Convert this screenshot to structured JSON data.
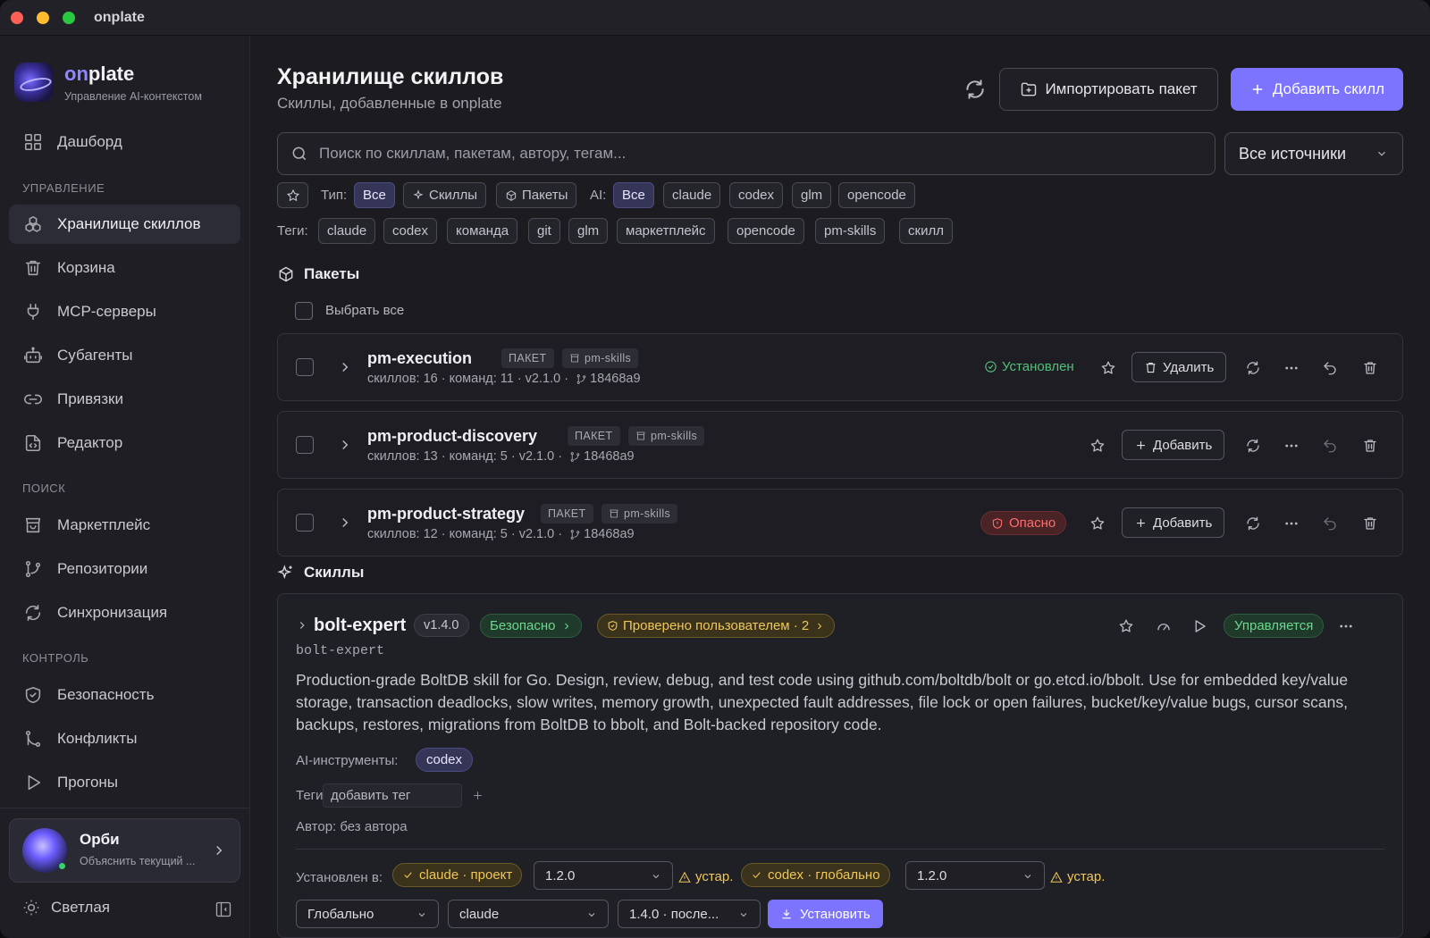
{
  "window": {
    "title": "onplate"
  },
  "brand": {
    "name_accent": "on",
    "name_rest": "plate",
    "subtitle": "Управление AI-контекстом"
  },
  "sidebar": {
    "dashboard": "Дашборд",
    "section_manage": "УПРАВЛЕНИЕ",
    "skills": "Хранилище скиллов",
    "trash": "Корзина",
    "mcp": "MCP-серверы",
    "subagents": "Субагенты",
    "bindings": "Привязки",
    "editor": "Редактор",
    "section_search": "ПОИСК",
    "marketplace": "Маркетплейс",
    "repos": "Репозитории",
    "sync": "Синхронизация",
    "section_control": "КОНТРОЛЬ",
    "security": "Безопасность",
    "conflicts": "Конфликты",
    "runs": "Прогоны",
    "orbi_name": "Орби",
    "orbi_sub": "Объяснить текущий ...",
    "theme": "Светлая"
  },
  "header": {
    "title": "Хранилище скиллов",
    "subtitle": "Скиллы, добавленные в onplate",
    "import_label": "Импортировать пакет",
    "add_label": "Добавить скилл"
  },
  "search": {
    "placeholder": "Поиск по скиллам, пакетам, автору, тегам...",
    "source_select": "Все источники"
  },
  "filters": {
    "type_label": "Тип:",
    "type_all": "Все",
    "type_skills": "Скиллы",
    "type_packages": "Пакеты",
    "ai_label": "AI:",
    "ai_options": [
      "Все",
      "claude",
      "codex",
      "glm",
      "opencode"
    ],
    "tags_label": "Теги:",
    "tags": [
      "claude",
      "codex",
      "команда",
      "git",
      "glm",
      "маркетплейс",
      "opencode",
      "pm-skills",
      "скилл"
    ]
  },
  "packages": {
    "title": "Пакеты",
    "select_all": "Выбрать все",
    "badge": "ПАКЕТ",
    "items": [
      {
        "name": "pm-execution",
        "source": "pm-skills",
        "meta": "скиллов: 16 · команд: 11 · v2.1.0 ·",
        "commit": "18468a9",
        "status": "Установлен",
        "action": "Удалить"
      },
      {
        "name": "pm-product-discovery",
        "source": "pm-skills",
        "meta": "скиллов: 13 · команд: 5 · v2.1.0 ·",
        "commit": "18468a9",
        "action": "Добавить"
      },
      {
        "name": "pm-product-strategy",
        "source": "pm-skills",
        "meta": "скиллов: 12 · команд: 5 · v2.1.0 ·",
        "commit": "18468a9",
        "status": "Опасно",
        "action": "Добавить"
      }
    ]
  },
  "skills": {
    "title": "Скиллы",
    "card": {
      "name": "bolt-expert",
      "version": "v1.4.0",
      "safe": "Безопасно",
      "checked": "Проверено пользователем · 2",
      "managed": "Управляется",
      "id": "bolt-expert",
      "description": "Production-grade BoltDB skill for Go. Design, review, debug, and test code using github.com/boltdb/bolt or go.etcd.io/bbolt. Use for embedded key/value storage, transaction deadlocks, slow writes, memory growth, unexpected fault addresses, file lock or open failures, bucket/key/value bugs, cursor scans, backups, restores, migrations from BoltDB to bbolt, and Bolt-backed repository code.",
      "ai_tools_label": "AI-инструменты:",
      "ai_tool": "codex",
      "tags_label": "Теги:",
      "tag_placeholder": "добавить тег",
      "author": "Автор: без автора",
      "installed_label": "Установлен в:",
      "inst1": "claude · проект",
      "inst1_ver": "1.2.0",
      "inst2": "codex · глобально",
      "inst2_ver": "1.2.0",
      "outdated": "устар.",
      "scope_select": "Глобально",
      "tool_select": "claude",
      "version_select": "1.4.0 · после...",
      "install_label": "Установить"
    }
  },
  "colors": {
    "accent": "#7c74ff",
    "ok": "#53c07a",
    "danger": "#ff6e6e",
    "warn": "#f0c75a"
  }
}
